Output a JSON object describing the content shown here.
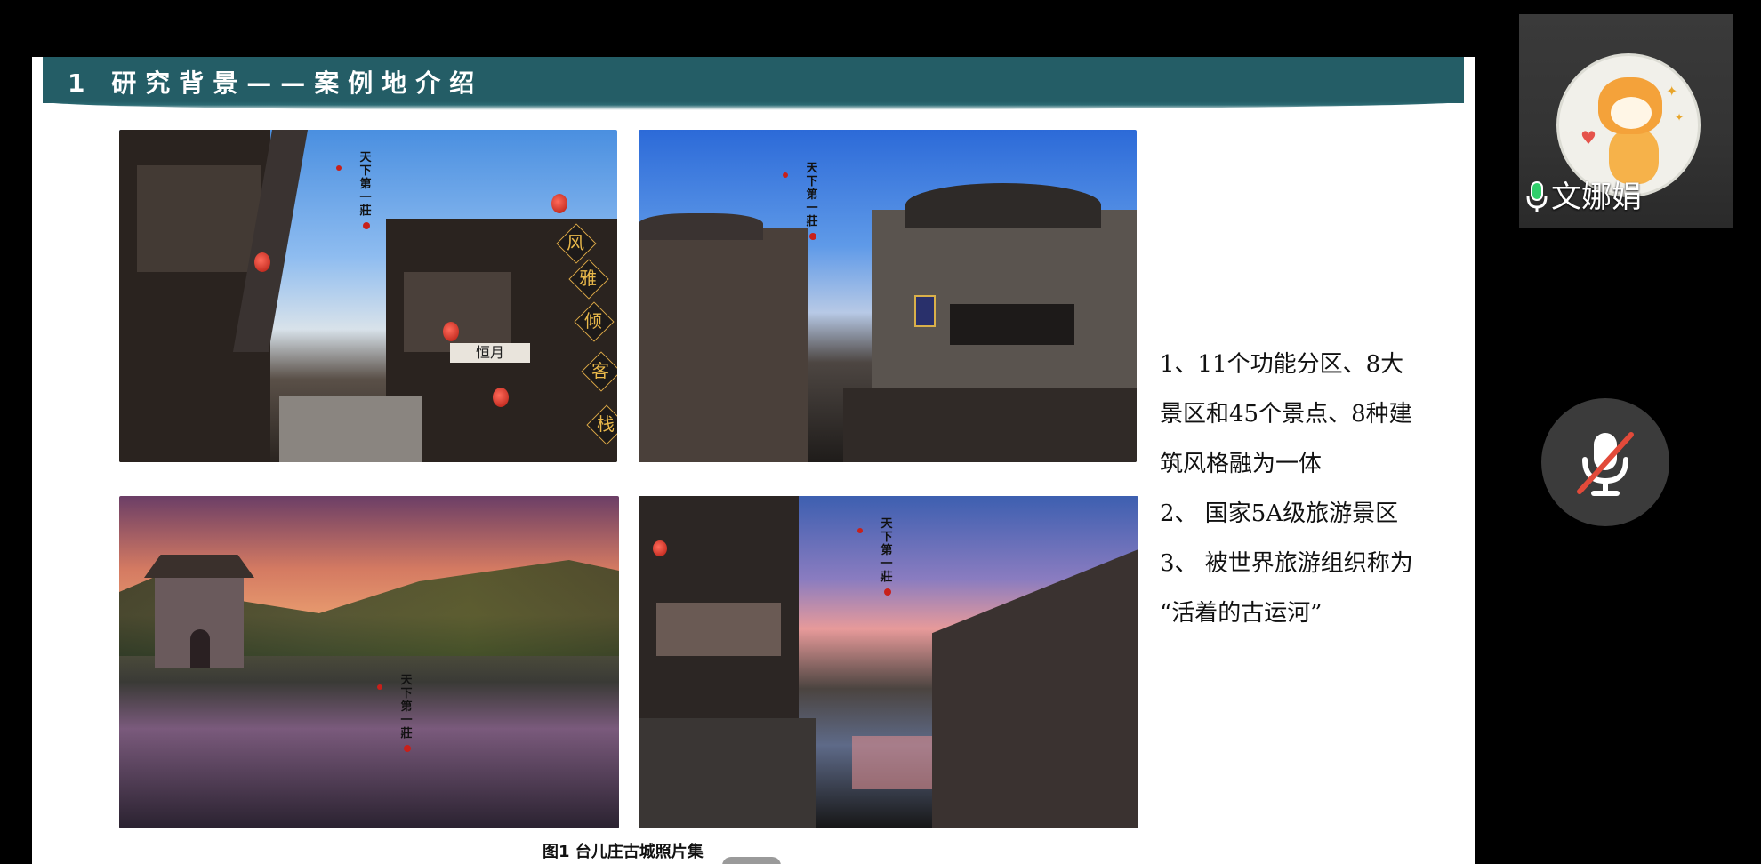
{
  "slide": {
    "title": "1   研究背景——案例地介绍",
    "photos": [
      {
        "name": "photo-1",
        "seal_text": "天下第一莊",
        "signs": [
          "风",
          "雅",
          "倾",
          "客",
          "栈"
        ],
        "plaque": "恒月"
      },
      {
        "name": "photo-2",
        "seal_text": "天下第一莊"
      },
      {
        "name": "photo-3",
        "seal_text": "天下第一莊"
      },
      {
        "name": "photo-4",
        "seal_text": "天下第一莊"
      }
    ],
    "caption": "图1 台儿庄古城照片集",
    "bullets": [
      "1、11个功能分区、8大",
      "景区和45个景点、8种建",
      "筑风格融为一体",
      "2、 国家5A级旅游景区",
      "3、 被世界旅游组织称为",
      "“活着的古运河”"
    ]
  },
  "participant": {
    "name": "文娜娟",
    "mic_status": "speaking",
    "avatar": "tiger-cartoon-avatar"
  },
  "controls": {
    "mute_button": {
      "icon": "mic-muted-icon",
      "state": "muted"
    }
  },
  "colors": {
    "title_bar": "#245d66",
    "mic_active": "#2fcf6b",
    "mute_slash": "#e24a3a"
  }
}
